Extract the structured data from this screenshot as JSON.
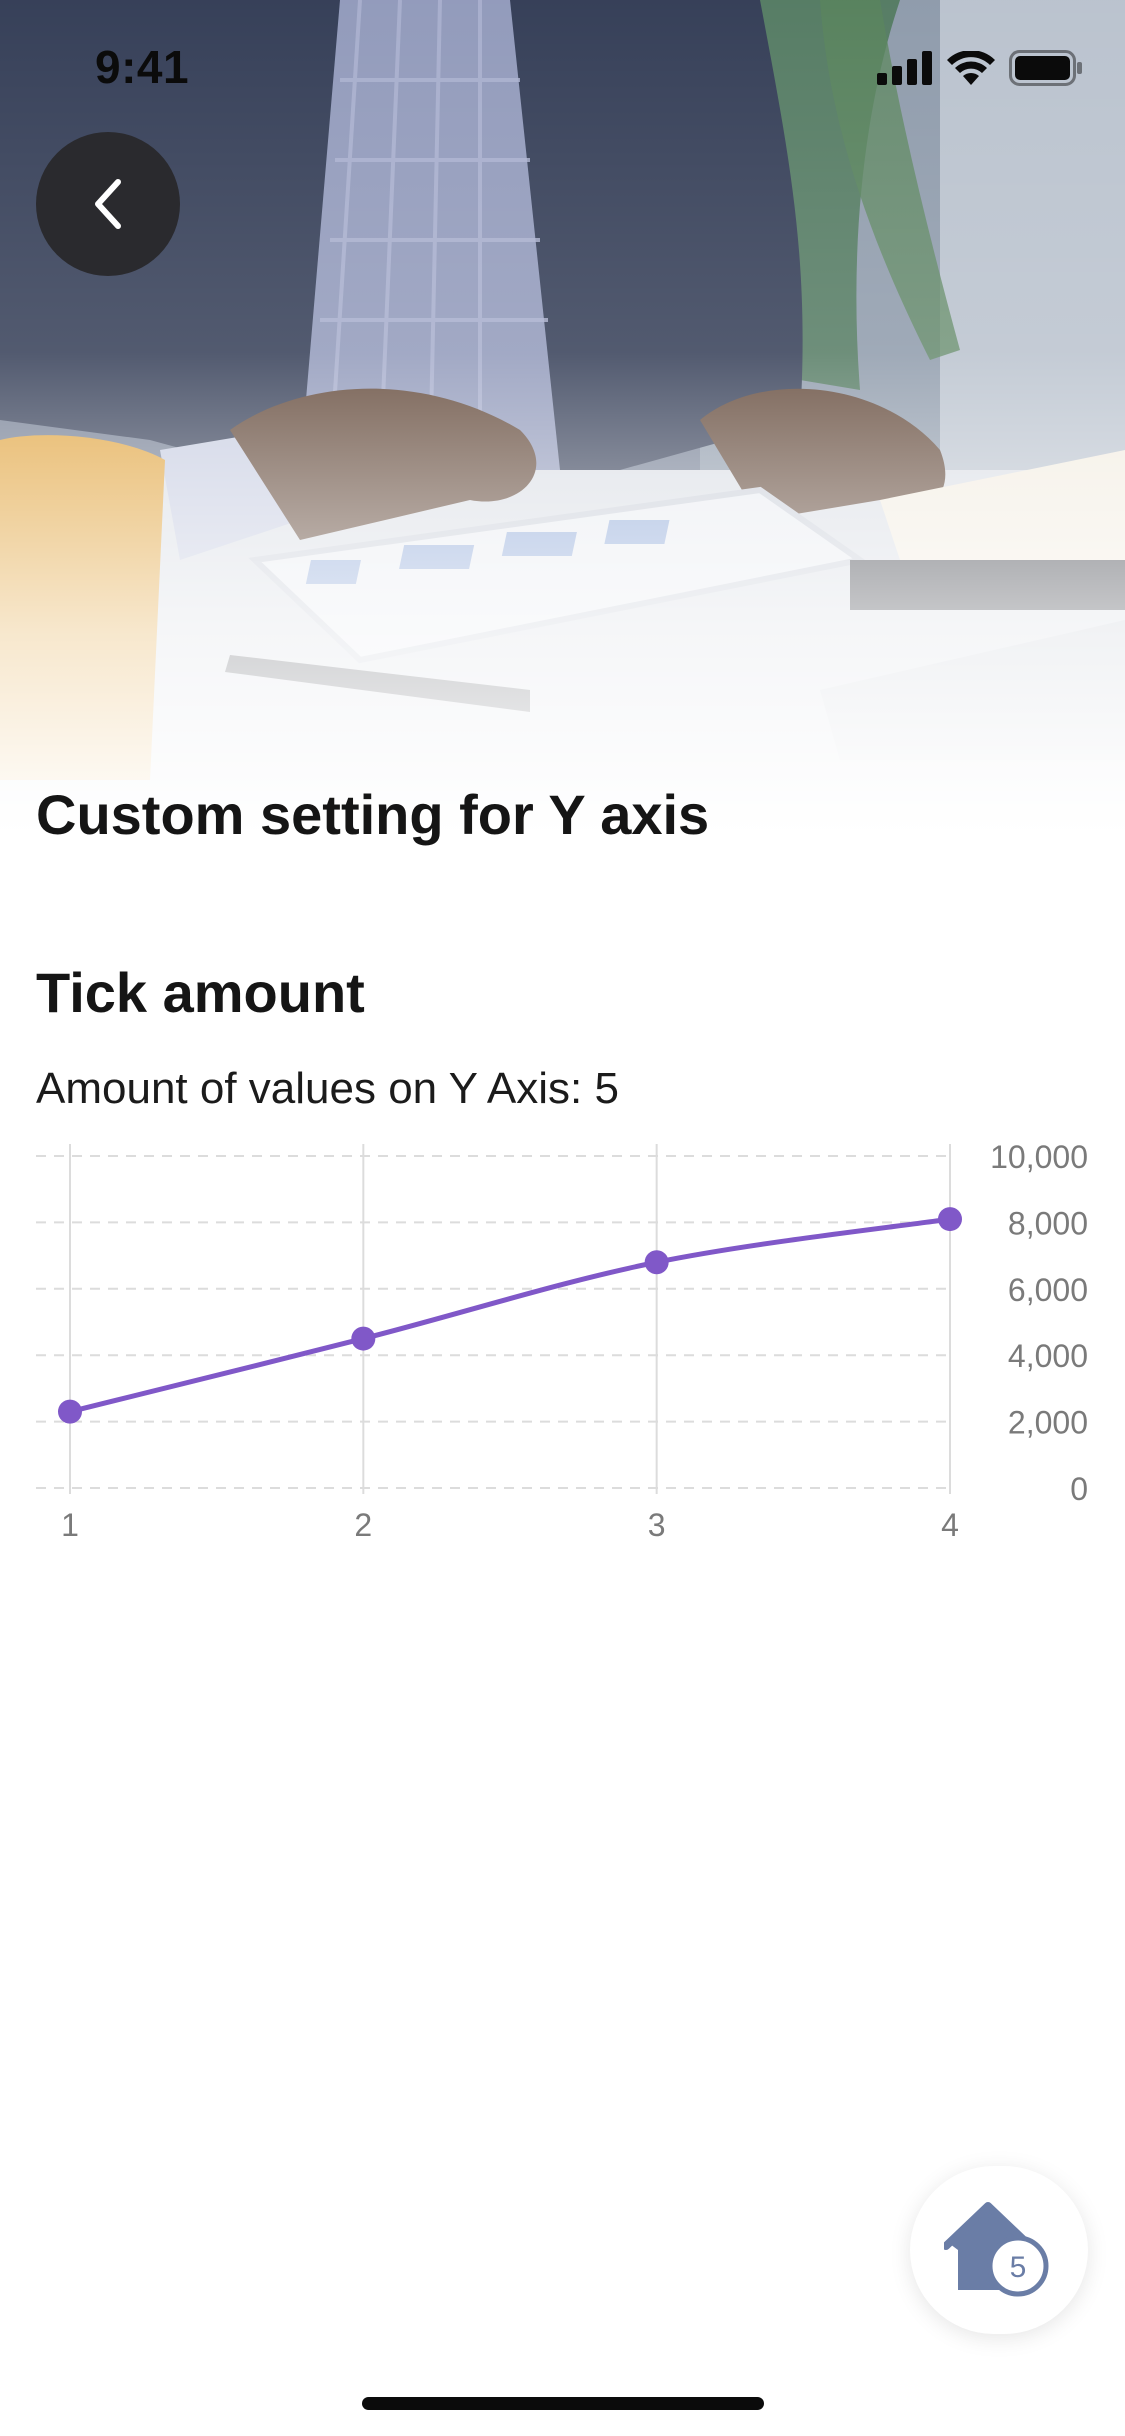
{
  "status_bar": {
    "time": "9:41"
  },
  "header": {
    "title": "Custom setting for Y axis"
  },
  "section": {
    "title": "Tick amount",
    "subtitle": "Amount of values on Y Axis: 5"
  },
  "chart_data": {
    "type": "line",
    "x": [
      1,
      2,
      3,
      4
    ],
    "series": [
      {
        "values": [
          2300,
          4500,
          6800,
          8100
        ],
        "color": "#8058c8"
      }
    ],
    "y_ticks": [
      "0",
      "2,000",
      "4,000",
      "6,000",
      "8,000",
      "10,000"
    ],
    "x_ticks": [
      "1",
      "2",
      "3",
      "4"
    ],
    "ylim": [
      0,
      10000
    ],
    "xlim": [
      1,
      4
    ],
    "y_axis_position": "right",
    "tick_amount": 5,
    "grid": true,
    "smooth": true
  },
  "home_fab": {
    "badge": "5",
    "icon": "home-icon"
  },
  "colors": {
    "accent": "#8058c8",
    "grid": "#dcdcdc",
    "tick": "#7a7a7a"
  }
}
